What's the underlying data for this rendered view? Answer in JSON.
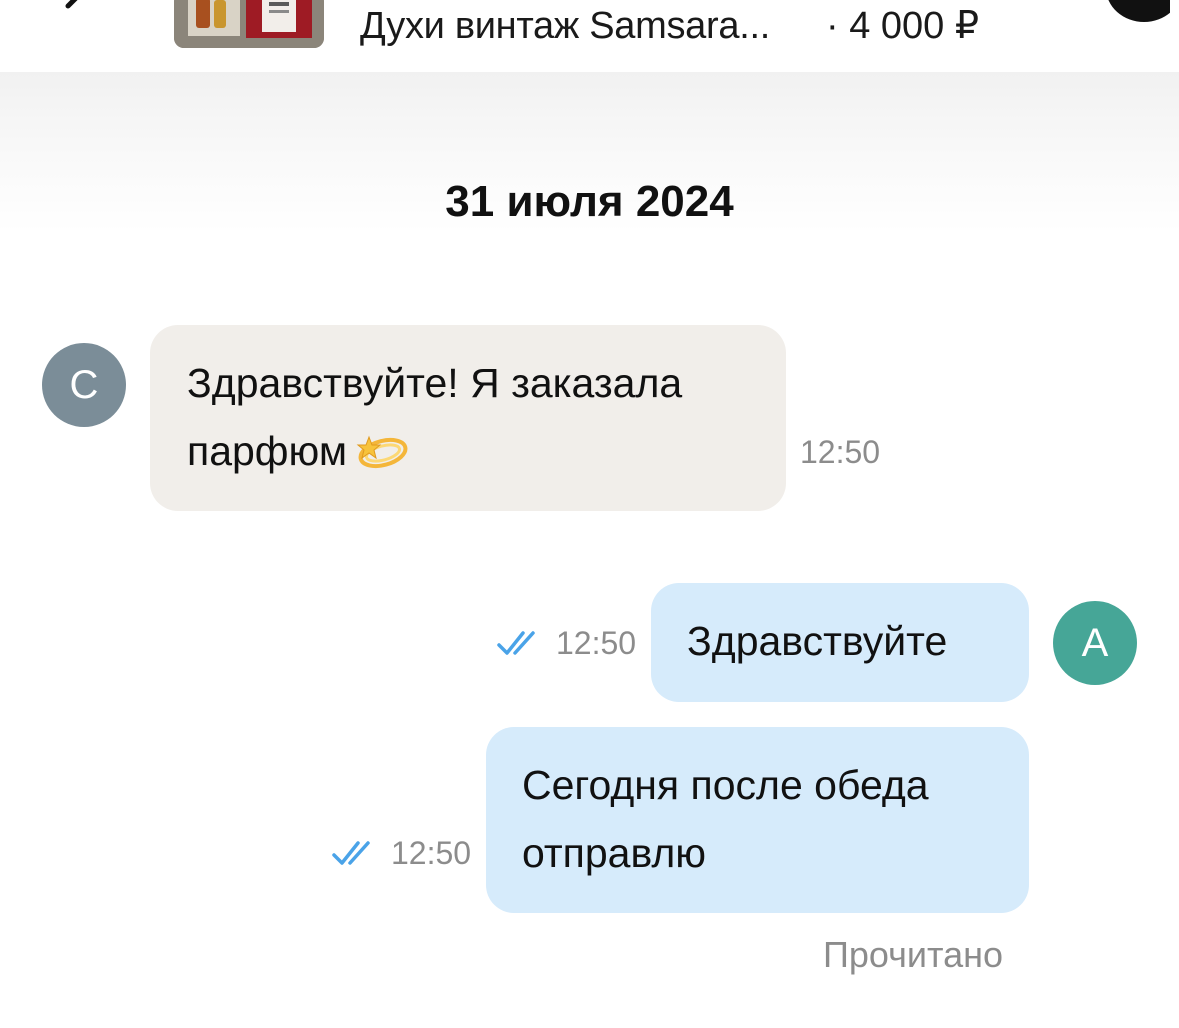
{
  "header": {
    "product_title": "Духи винтаж Samsara...",
    "product_price": "· 4 000 ₽",
    "back_icon": "chevron-left-icon",
    "menu_icon": "more-icon"
  },
  "chat": {
    "date": "31 июля 2024",
    "participants": {
      "seller_initial": "С",
      "me_initial": "А"
    },
    "messages": [
      {
        "direction": "incoming",
        "lines": [
          "Здравствуйте! Я заказала",
          "парфюм"
        ],
        "emoji": "dizzy-star-emoji",
        "time": "12:50"
      },
      {
        "direction": "outgoing",
        "lines": [
          "Здравствуйте"
        ],
        "time": "12:50",
        "status_icon": "double-check-icon"
      },
      {
        "direction": "outgoing",
        "lines": [
          "Сегодня после обеда",
          "отправлю"
        ],
        "time": "12:50",
        "status_icon": "double-check-icon"
      }
    ],
    "read_status": "Прочитано"
  },
  "colors": {
    "incoming_bubble": "#f1eeea",
    "outgoing_bubble": "#d6ebfb",
    "seller_avatar": "#7b8d98",
    "my_avatar": "#46a697",
    "check_icon": "#4aa3e8",
    "muted_text": "#8c8c8c"
  }
}
